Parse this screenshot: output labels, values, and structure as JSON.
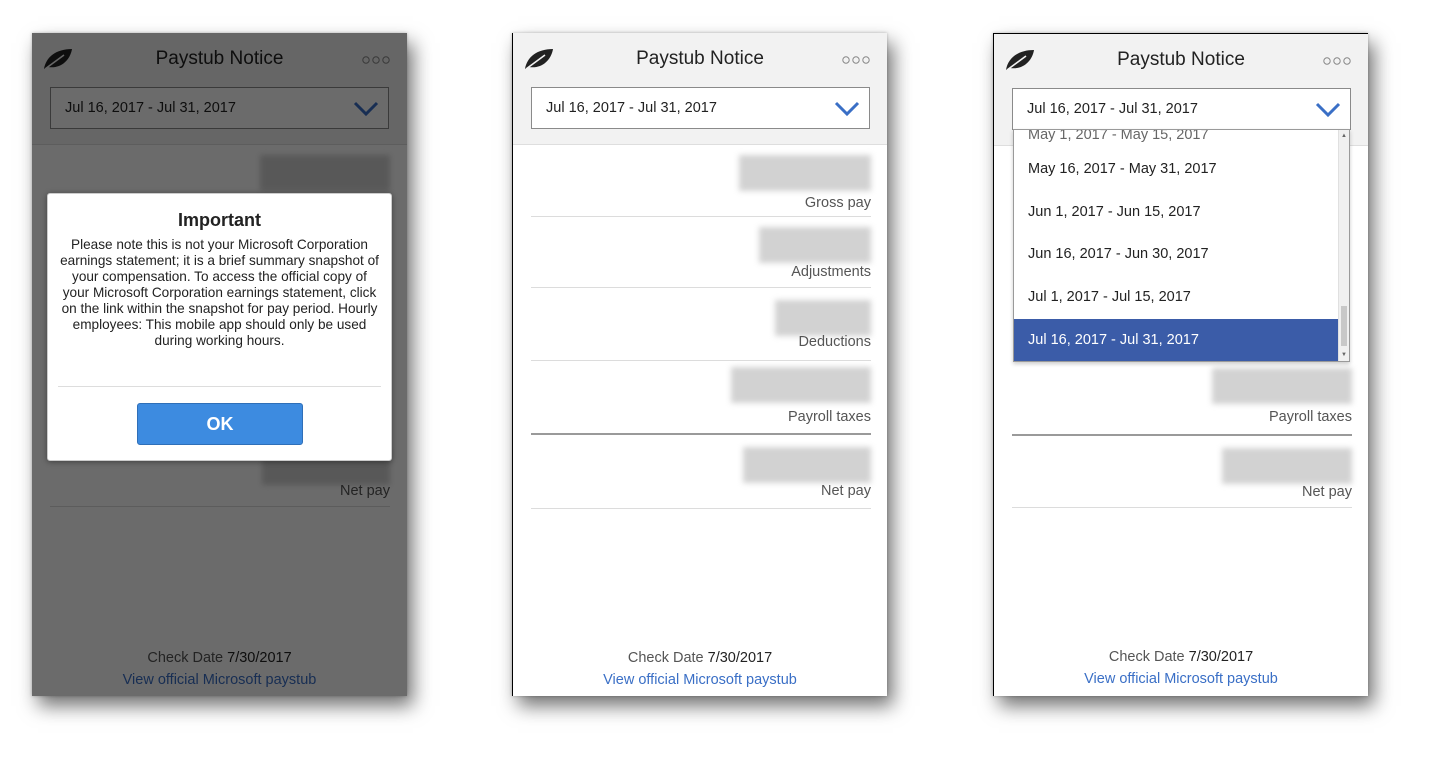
{
  "app": {
    "title": "Paystub Notice",
    "accent_color": "#3a6fc6",
    "icons": {
      "logo": "leaf-icon",
      "menu": "more-dots-icon",
      "dropdown": "chevron-down-icon"
    }
  },
  "period_select": {
    "value": "Jul 16, 2017 - Jul 31, 2017"
  },
  "summary_rows": [
    {
      "label": "Gross pay"
    },
    {
      "label": "Adjustments"
    },
    {
      "label": "Deductions"
    },
    {
      "label": "Payroll taxes"
    },
    {
      "label": "Net pay"
    }
  ],
  "footer": {
    "check_date_label": "Check Date",
    "check_date_value": "7/30/2017",
    "paystub_link": "View official Microsoft paystub"
  },
  "modal": {
    "title": "Important",
    "body": "Please note this is not your Microsoft Corporation earnings statement; it is a brief summary snapshot of your compensation. To access the official copy of your Microsoft Corporation earnings statement, click on the link within the snapshot for pay period. Hourly employees: This mobile app should only be used during working hours.",
    "ok_label": "OK",
    "button_color": "#3d8be0"
  },
  "dropdown": {
    "partial_option": "May 1, 2017 - May 15, 2017",
    "options": [
      "May 16, 2017 - May 31, 2017",
      "Jun 1, 2017 - Jun 15, 2017",
      "Jun 16, 2017 - Jun 30, 2017",
      "Jul 1, 2017 - Jul 15, 2017",
      "Jul 16, 2017 - Jul 31, 2017"
    ],
    "selected_index": 4,
    "selected_color": "#3b5ca8"
  }
}
